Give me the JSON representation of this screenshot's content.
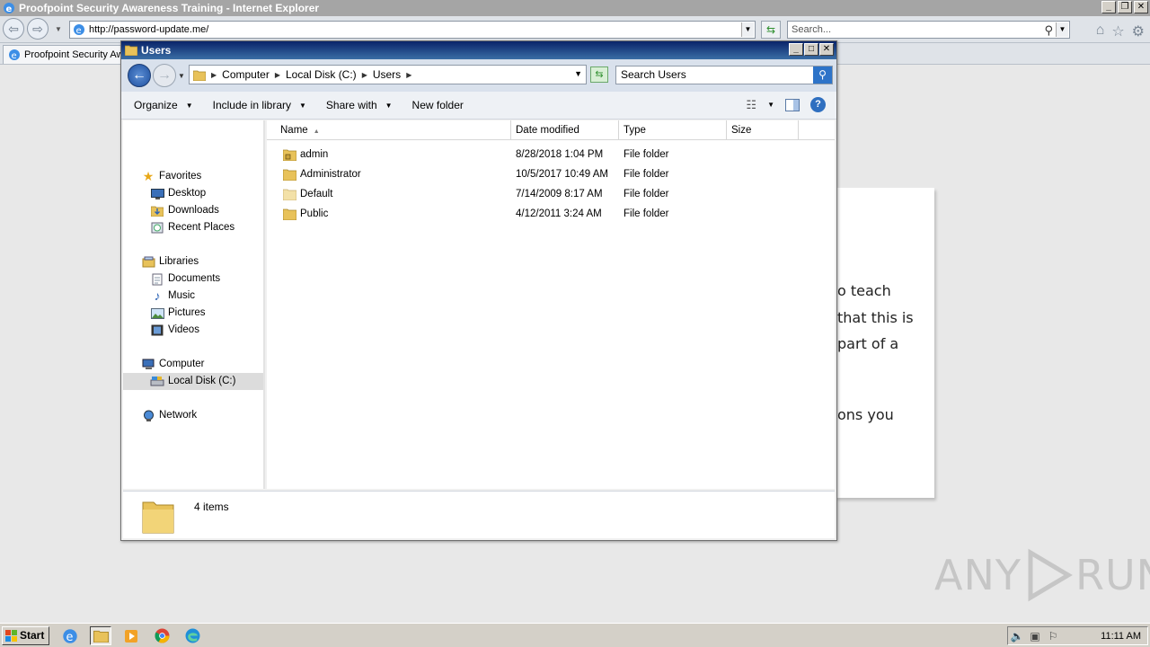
{
  "ie": {
    "title": "Proofpoint Security Awareness Training - Internet Explorer",
    "address": "http://password-update.me/",
    "search_placeholder": "Search...",
    "tab_label": "Proofpoint Security Aw..."
  },
  "page": {
    "lines": [
      "o teach",
      "that this is",
      "part of a",
      "ons you"
    ]
  },
  "explorer": {
    "title": "Users",
    "breadcrumb": [
      "Computer",
      "Local Disk (C:)",
      "Users"
    ],
    "search_placeholder": "Search Users",
    "toolbar": {
      "organize": "Organize",
      "include": "Include in library",
      "share": "Share with",
      "new_folder": "New folder"
    },
    "nav": {
      "favorites": "Favorites",
      "desktop": "Desktop",
      "downloads": "Downloads",
      "recent": "Recent Places",
      "libraries": "Libraries",
      "documents": "Documents",
      "music": "Music",
      "pictures": "Pictures",
      "videos": "Videos",
      "computer": "Computer",
      "local_disk": "Local Disk (C:)",
      "network": "Network"
    },
    "columns": {
      "name": "Name",
      "date": "Date modified",
      "type": "Type",
      "size": "Size"
    },
    "rows": [
      {
        "name": "admin",
        "date": "8/28/2018 1:04 PM",
        "type": "File folder"
      },
      {
        "name": "Administrator",
        "date": "10/5/2017 10:49 AM",
        "type": "File folder"
      },
      {
        "name": "Default",
        "date": "7/14/2009 8:17 AM",
        "type": "File folder"
      },
      {
        "name": "Public",
        "date": "4/12/2011 3:24 AM",
        "type": "File folder"
      }
    ],
    "status": "4 items"
  },
  "watermark": {
    "left": "ANY",
    "right": "RUN"
  },
  "taskbar": {
    "start": "Start",
    "clock": "11:11 AM"
  },
  "colors": {
    "ie_title_bg": "#a5a5a5",
    "explorer_title_bg": "#0a246a",
    "folder": "#e8c25a"
  }
}
